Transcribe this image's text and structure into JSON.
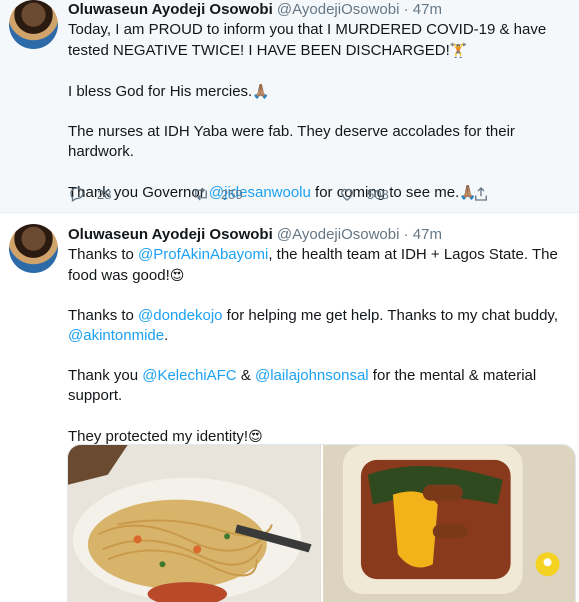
{
  "tweets": [
    {
      "name": "Oluwaseun Ayodeji Osowobi",
      "handle": "@AyodejiOsowobi",
      "time": "· 47m",
      "para1": "Today, I am PROUD to inform you that I MURDERED COVID-19 & have tested NEGATIVE TWICE! I HAVE BEEN DISCHARGED!",
      "emoji1": "🏋",
      "para2": "I bless God for His mercies.",
      "emoji2": "🙏🏽",
      "para3": "The nurses at IDH Yaba were fab. They deserve accolades for their hardwork.",
      "para4_pre": "Thank you Governor ",
      "para4_mention": "@jidesanwoolu",
      "para4_post": " for coming to see me.",
      "emoji4": "🙏🏽",
      "actions": {
        "replies": "28",
        "retweets": "259",
        "likes": "508"
      }
    },
    {
      "name": "Oluwaseun Ayodeji Osowobi",
      "handle": "@AyodejiOsowobi",
      "time": "· 47m",
      "p1_pre": "Thanks to ",
      "p1_mention": "@ProfAkinAbayomi",
      "p1_post": ", the health team at IDH + Lagos State. The food was good!",
      "p1_emoji": "😍",
      "p2_pre": "Thanks to ",
      "p2_mention1": "@dondekojo",
      "p2_mid": " for helping me get help. Thanks to my chat buddy, ",
      "p2_mention2": "@akintonmide",
      "p2_post": ".",
      "p3_pre": "Thank you ",
      "p3_mention1": "@KelechiAFC",
      "p3_mid": " & ",
      "p3_mention2": "@lailajohnsonsal",
      "p3_post": " for the mental & material support.",
      "p4": "They protected my identity!",
      "p4_emoji": "😍"
    }
  ],
  "colors": {
    "accent": "#1da1f2",
    "text": "#14171a",
    "muted": "#657786",
    "highlight_bg": "#f5f8fa"
  },
  "icons": [
    "reply-icon",
    "retweet-icon",
    "like-icon",
    "share-icon"
  ]
}
